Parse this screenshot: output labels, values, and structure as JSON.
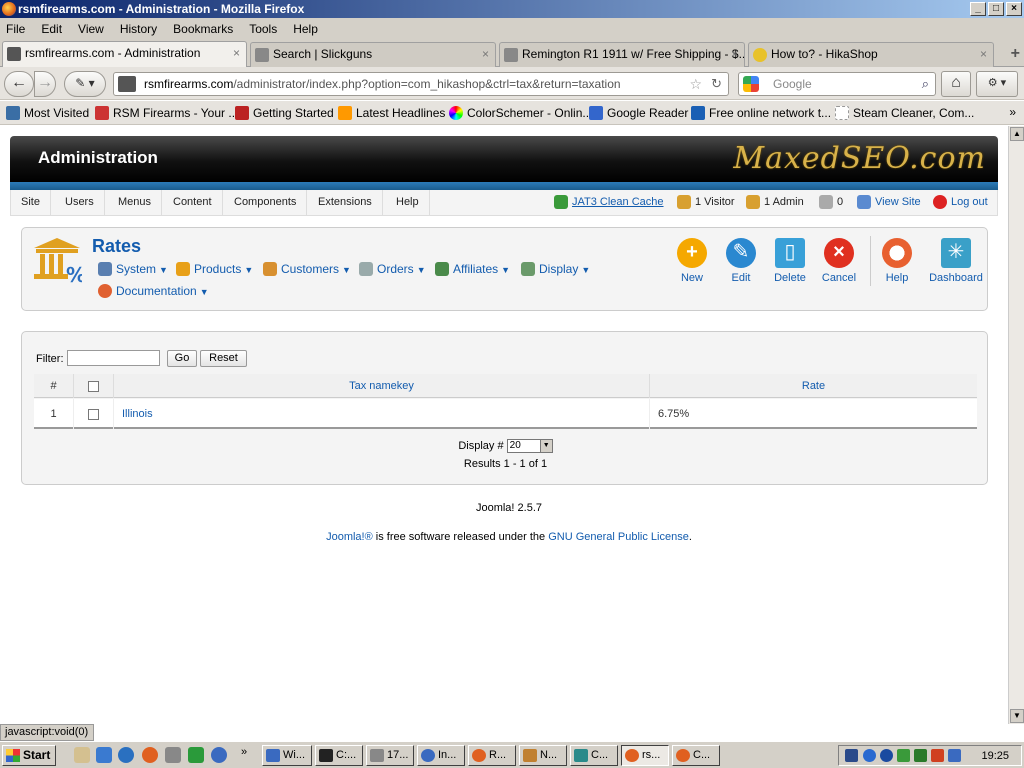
{
  "window": {
    "title": "rsmfirearms.com - Administration - Mozilla Firefox"
  },
  "menu": [
    "File",
    "Edit",
    "View",
    "History",
    "Bookmarks",
    "Tools",
    "Help"
  ],
  "tabs": [
    {
      "label": "rsmfirearms.com - Administration"
    },
    {
      "label": "Search | Slickguns"
    },
    {
      "label": "Remington R1 1911 w/ Free Shipping - $..."
    },
    {
      "label": "How to? - HikaShop"
    }
  ],
  "url": {
    "host": "rsmfirearms.com",
    "path": "/administrator/index.php?option=com_hikashop&ctrl=tax&return=taxation"
  },
  "search": {
    "placeholder": "Google"
  },
  "bookmarks": [
    "Most Visited",
    "RSM Firearms - Your ...",
    "Getting Started",
    "Latest Headlines",
    "ColorSchemer - Onlin...",
    "Google Reader",
    "Free online network t...",
    "Steam Cleaner, Com..."
  ],
  "admin": {
    "header_title": "Administration",
    "logo_text": "MaxedSEO.com",
    "topnav": [
      "Site",
      "Users",
      "Menus",
      "Content",
      "Components",
      "Extensions",
      "Help"
    ],
    "status": {
      "cache": "JAT3 Clean Cache",
      "visitors": "1 Visitor",
      "admins": "1 Admin",
      "messages": "0",
      "view_site": "View Site",
      "logout": "Log out"
    }
  },
  "rates": {
    "title": "Rates",
    "submenu": [
      "System",
      "Products",
      "Customers",
      "Orders",
      "Affiliates",
      "Display",
      "Documentation"
    ],
    "toolbar": [
      "New",
      "Edit",
      "Delete",
      "Cancel",
      "Help",
      "Dashboard"
    ],
    "filter": {
      "label": "Filter:",
      "value": "",
      "go": "Go",
      "reset": "Reset"
    },
    "columns": {
      "num": "#",
      "namekey": "Tax namekey",
      "rate": "Rate"
    },
    "rows": [
      {
        "num": "1",
        "namekey": "Illinois",
        "rate": "6.75%"
      }
    ],
    "pager": {
      "label": "Display #",
      "value": "20",
      "results": "Results 1 - 1 of 1"
    }
  },
  "footer": {
    "version": "Joomla! 2.5.7",
    "joomla_link": "Joomla!®",
    "free_text": " is free software released under the ",
    "license": "GNU General Public License",
    "end": "."
  },
  "statusbar": "javascript:void(0)",
  "taskbar": {
    "start": "Start",
    "items": [
      "Wi...",
      "C:...",
      "17...",
      "In...",
      "R...",
      "N...",
      "C...",
      "rs...",
      "C..."
    ],
    "clock": "19:25"
  }
}
